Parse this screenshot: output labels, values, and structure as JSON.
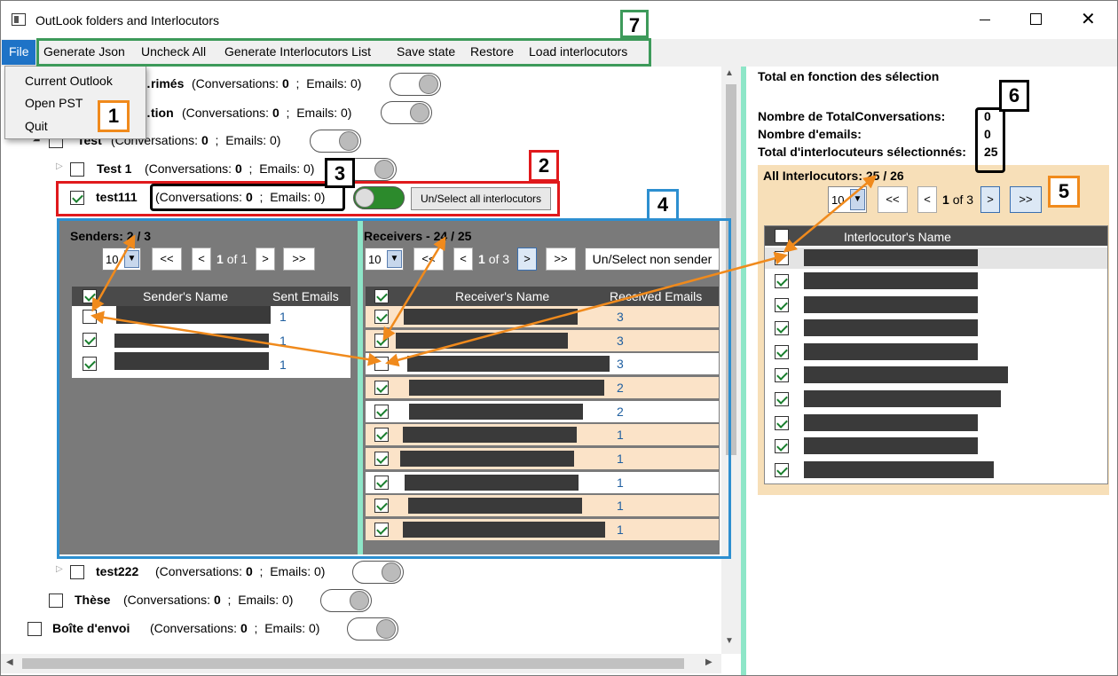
{
  "window": {
    "title": "OutLook folders and Interlocutors"
  },
  "menu": {
    "file": "File",
    "items": [
      "Generate Json",
      "Uncheck All",
      "Generate Interlocutors List",
      "Save state",
      "Restore",
      "Load interlocutors"
    ],
    "dropdown": [
      "Current Outlook",
      "Open PST",
      "Quit"
    ]
  },
  "tree": {
    "rows": [
      {
        "name": "…rimés",
        "conv_label": "(Conversations:",
        "conv": "0",
        "sep": ";",
        "emails_label": "Emails:",
        "emails": "0)"
      },
      {
        "name": "…tion",
        "conv_label": "(Conversations:",
        "conv": "0",
        "sep": ";",
        "emails_label": "Emails:",
        "emails": "0)"
      },
      {
        "name": "Test",
        "conv_label": "(Conversations:",
        "conv": "0",
        "sep": ";",
        "emails_label": "Emails:",
        "emails": "0)"
      },
      {
        "name": "Test 1",
        "conv_label": "(Conversations:",
        "conv": "0",
        "sep": ";",
        "emails_label": "Emails:",
        "emails": "0)"
      },
      {
        "name": "test111",
        "conv_label": "(Conversations:",
        "conv": "0",
        "sep": ";",
        "emails_label": "Emails:",
        "emails": "0)"
      },
      {
        "name": "test222",
        "conv_label": "(Conversations:",
        "conv": "0",
        "sep": ";",
        "emails_label": "Emails:",
        "emails": "0)"
      },
      {
        "name": "Thèse",
        "conv_label": "(Conversations:",
        "conv": "0",
        "sep": ";",
        "emails_label": "Emails:",
        "emails": "0)"
      },
      {
        "name": "Boîte d'envoi",
        "conv_label": "(Conversations:",
        "conv": "0",
        "sep": ";",
        "emails_label": "Emails:",
        "emails": "0)"
      }
    ],
    "select_all_btn": "Un/Select all interlocutors"
  },
  "senders": {
    "title": "Senders: 2 / 3",
    "page_size": "10",
    "first": "<<",
    "prev": "<",
    "page": "1",
    "of": "of 1",
    "next": ">",
    "last": ">>",
    "col_name": "Sender's Name",
    "col_count": "Sent Emails",
    "counts": [
      "1",
      "1",
      "1"
    ]
  },
  "receivers": {
    "title": "Receivers - 24 / 25",
    "page_size": "10",
    "first": "<<",
    "prev": "<",
    "page": "1",
    "of": "of 3",
    "next": ">",
    "last": ">>",
    "non_sender_btn": "Un/Select non sender",
    "col_name": "Receiver's Name",
    "col_count": "Received Emails",
    "counts": [
      "3",
      "3",
      "3",
      "2",
      "2",
      "1",
      "1",
      "1",
      "1",
      "1"
    ]
  },
  "totals": {
    "title": "Total en fonction des sélection",
    "conv_label": "Nombre de TotalConversations:",
    "conv": "0",
    "emails_label": "Nombre d'emails:",
    "emails": "0",
    "inter_label": "Total d'interlocuteurs sélectionnés:",
    "inter": "25"
  },
  "all_interlocutors": {
    "title": "All Interlocutors: 25 / 26",
    "page_size": "10",
    "first": "<<",
    "prev": "<",
    "page": "1",
    "of": "of 3",
    "next": ">",
    "last": ">>",
    "col_name": "Interlocutor's Name"
  },
  "callouts": [
    "1",
    "2",
    "3",
    "4",
    "5",
    "6",
    "7"
  ],
  "colors": {
    "orange": "#f08a1c",
    "red": "#e0191c",
    "blue": "#2d8fd0",
    "black": "#000000",
    "green": "#3d9a5a",
    "menu_blue": "#1e73c7"
  }
}
